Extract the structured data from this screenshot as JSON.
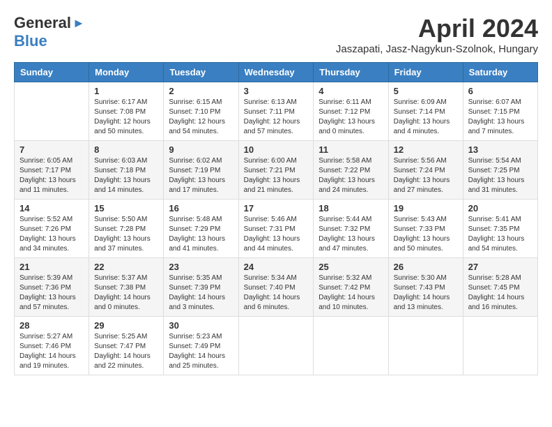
{
  "header": {
    "logo_general": "General",
    "logo_blue": "Blue",
    "month_title": "April 2024",
    "location": "Jaszapati, Jasz-Nagykun-Szolnok, Hungary"
  },
  "columns": [
    "Sunday",
    "Monday",
    "Tuesday",
    "Wednesday",
    "Thursday",
    "Friday",
    "Saturday"
  ],
  "weeks": [
    {
      "days": [
        {
          "num": "",
          "info": ""
        },
        {
          "num": "1",
          "info": "Sunrise: 6:17 AM\nSunset: 7:08 PM\nDaylight: 12 hours\nand 50 minutes."
        },
        {
          "num": "2",
          "info": "Sunrise: 6:15 AM\nSunset: 7:10 PM\nDaylight: 12 hours\nand 54 minutes."
        },
        {
          "num": "3",
          "info": "Sunrise: 6:13 AM\nSunset: 7:11 PM\nDaylight: 12 hours\nand 57 minutes."
        },
        {
          "num": "4",
          "info": "Sunrise: 6:11 AM\nSunset: 7:12 PM\nDaylight: 13 hours\nand 0 minutes."
        },
        {
          "num": "5",
          "info": "Sunrise: 6:09 AM\nSunset: 7:14 PM\nDaylight: 13 hours\nand 4 minutes."
        },
        {
          "num": "6",
          "info": "Sunrise: 6:07 AM\nSunset: 7:15 PM\nDaylight: 13 hours\nand 7 minutes."
        }
      ]
    },
    {
      "days": [
        {
          "num": "7",
          "info": "Sunrise: 6:05 AM\nSunset: 7:17 PM\nDaylight: 13 hours\nand 11 minutes."
        },
        {
          "num": "8",
          "info": "Sunrise: 6:03 AM\nSunset: 7:18 PM\nDaylight: 13 hours\nand 14 minutes."
        },
        {
          "num": "9",
          "info": "Sunrise: 6:02 AM\nSunset: 7:19 PM\nDaylight: 13 hours\nand 17 minutes."
        },
        {
          "num": "10",
          "info": "Sunrise: 6:00 AM\nSunset: 7:21 PM\nDaylight: 13 hours\nand 21 minutes."
        },
        {
          "num": "11",
          "info": "Sunrise: 5:58 AM\nSunset: 7:22 PM\nDaylight: 13 hours\nand 24 minutes."
        },
        {
          "num": "12",
          "info": "Sunrise: 5:56 AM\nSunset: 7:24 PM\nDaylight: 13 hours\nand 27 minutes."
        },
        {
          "num": "13",
          "info": "Sunrise: 5:54 AM\nSunset: 7:25 PM\nDaylight: 13 hours\nand 31 minutes."
        }
      ]
    },
    {
      "days": [
        {
          "num": "14",
          "info": "Sunrise: 5:52 AM\nSunset: 7:26 PM\nDaylight: 13 hours\nand 34 minutes."
        },
        {
          "num": "15",
          "info": "Sunrise: 5:50 AM\nSunset: 7:28 PM\nDaylight: 13 hours\nand 37 minutes."
        },
        {
          "num": "16",
          "info": "Sunrise: 5:48 AM\nSunset: 7:29 PM\nDaylight: 13 hours\nand 41 minutes."
        },
        {
          "num": "17",
          "info": "Sunrise: 5:46 AM\nSunset: 7:31 PM\nDaylight: 13 hours\nand 44 minutes."
        },
        {
          "num": "18",
          "info": "Sunrise: 5:44 AM\nSunset: 7:32 PM\nDaylight: 13 hours\nand 47 minutes."
        },
        {
          "num": "19",
          "info": "Sunrise: 5:43 AM\nSunset: 7:33 PM\nDaylight: 13 hours\nand 50 minutes."
        },
        {
          "num": "20",
          "info": "Sunrise: 5:41 AM\nSunset: 7:35 PM\nDaylight: 13 hours\nand 54 minutes."
        }
      ]
    },
    {
      "days": [
        {
          "num": "21",
          "info": "Sunrise: 5:39 AM\nSunset: 7:36 PM\nDaylight: 13 hours\nand 57 minutes."
        },
        {
          "num": "22",
          "info": "Sunrise: 5:37 AM\nSunset: 7:38 PM\nDaylight: 14 hours\nand 0 minutes."
        },
        {
          "num": "23",
          "info": "Sunrise: 5:35 AM\nSunset: 7:39 PM\nDaylight: 14 hours\nand 3 minutes."
        },
        {
          "num": "24",
          "info": "Sunrise: 5:34 AM\nSunset: 7:40 PM\nDaylight: 14 hours\nand 6 minutes."
        },
        {
          "num": "25",
          "info": "Sunrise: 5:32 AM\nSunset: 7:42 PM\nDaylight: 14 hours\nand 10 minutes."
        },
        {
          "num": "26",
          "info": "Sunrise: 5:30 AM\nSunset: 7:43 PM\nDaylight: 14 hours\nand 13 minutes."
        },
        {
          "num": "27",
          "info": "Sunrise: 5:28 AM\nSunset: 7:45 PM\nDaylight: 14 hours\nand 16 minutes."
        }
      ]
    },
    {
      "days": [
        {
          "num": "28",
          "info": "Sunrise: 5:27 AM\nSunset: 7:46 PM\nDaylight: 14 hours\nand 19 minutes."
        },
        {
          "num": "29",
          "info": "Sunrise: 5:25 AM\nSunset: 7:47 PM\nDaylight: 14 hours\nand 22 minutes."
        },
        {
          "num": "30",
          "info": "Sunrise: 5:23 AM\nSunset: 7:49 PM\nDaylight: 14 hours\nand 25 minutes."
        },
        {
          "num": "",
          "info": ""
        },
        {
          "num": "",
          "info": ""
        },
        {
          "num": "",
          "info": ""
        },
        {
          "num": "",
          "info": ""
        }
      ]
    }
  ]
}
